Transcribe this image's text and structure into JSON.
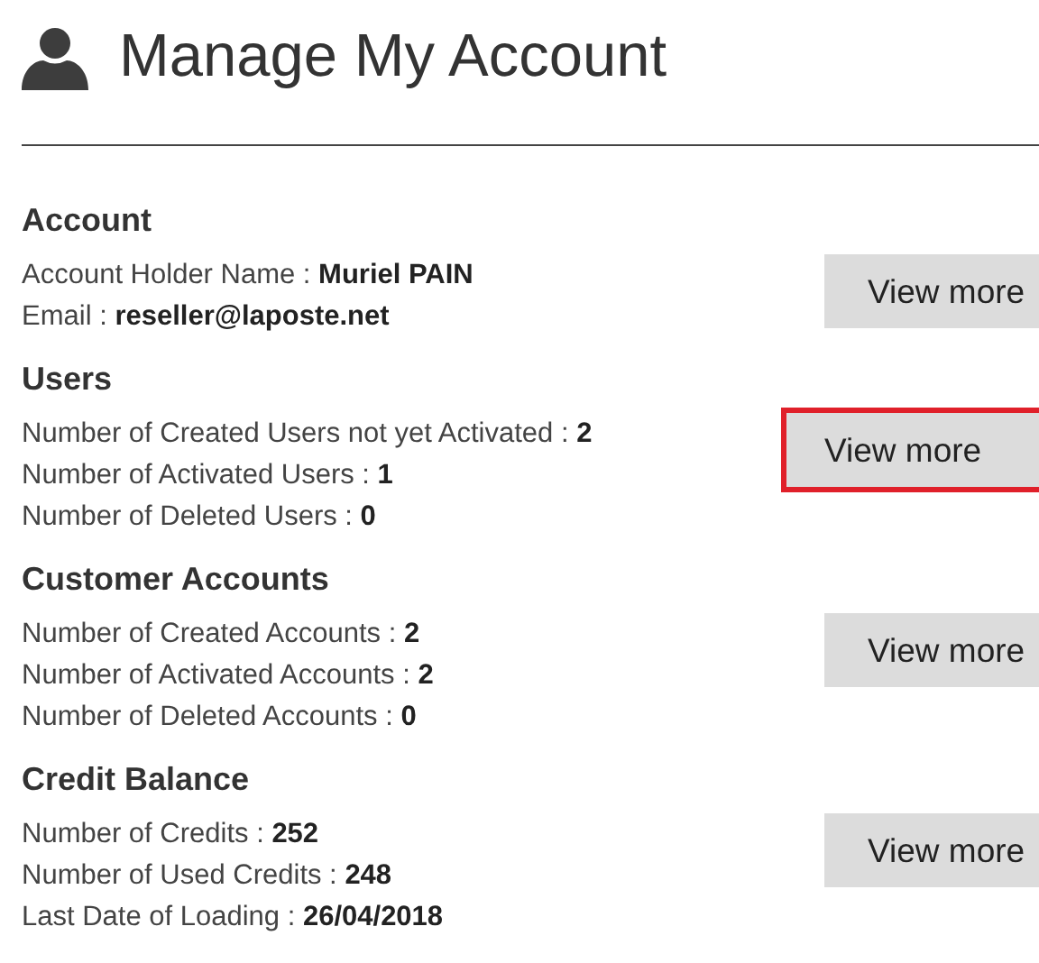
{
  "title": "Manage My Account",
  "sections": [
    {
      "heading": "Account",
      "button": {
        "label": "View more",
        "highlighted": false
      },
      "rows": [
        {
          "label": "Account Holder Name :",
          "value": "Muriel PAIN"
        },
        {
          "label": "Email :",
          "value": "reseller@laposte.net"
        }
      ]
    },
    {
      "heading": "Users",
      "button": {
        "label": "View more",
        "highlighted": true
      },
      "rows": [
        {
          "label": "Number of Created Users not yet Activated :",
          "value": "2"
        },
        {
          "label": "Number of Activated Users :",
          "value": "1"
        },
        {
          "label": "Number of Deleted Users :",
          "value": "0"
        }
      ]
    },
    {
      "heading": "Customer Accounts",
      "button": {
        "label": "View more",
        "highlighted": false
      },
      "rows": [
        {
          "label": "Number of Created Accounts :",
          "value": "2"
        },
        {
          "label": "Number of Activated Accounts :",
          "value": "2"
        },
        {
          "label": "Number of Deleted Accounts :",
          "value": "0"
        }
      ]
    },
    {
      "heading": "Credit Balance",
      "button": {
        "label": "View more",
        "highlighted": false
      },
      "rows": [
        {
          "label": "Number of Credits :",
          "value": "252"
        },
        {
          "label": "Number of Used Credits :",
          "value": "248"
        },
        {
          "label": "Last Date of Loading :",
          "value": "26/04/2018"
        }
      ]
    }
  ]
}
